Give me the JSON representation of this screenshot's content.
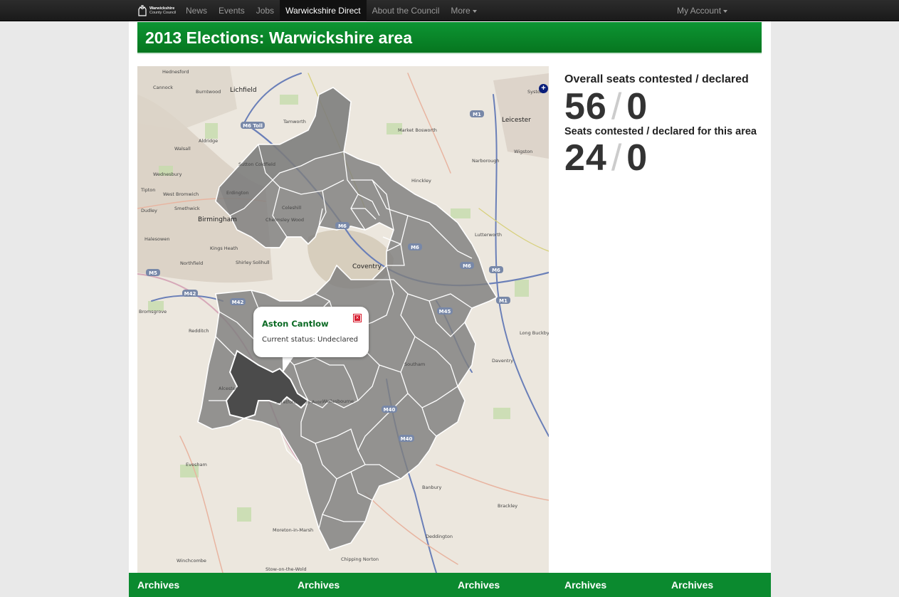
{
  "navbar": {
    "brand": {
      "line1": "Warwickshire",
      "line2": "County Council"
    },
    "items": [
      {
        "label": "News"
      },
      {
        "label": "Events"
      },
      {
        "label": "Jobs"
      },
      {
        "label": "Warwickshire Direct"
      },
      {
        "label": "About the Council"
      },
      {
        "label": "More"
      }
    ],
    "account": "My Account"
  },
  "page": {
    "title": "2013 Elections: Warwickshire area"
  },
  "map": {
    "colors": {
      "division_fill": "#7f7f7f",
      "selected_fill": "#4b4b4b",
      "boundary": "#ffffff"
    },
    "zoom_icon": "+",
    "labels": {
      "hednesford": "Hednesford",
      "cannock": "Cannock",
      "lichfield": "Lichfield",
      "burntwood": "Burntwood",
      "tamworth": "Tamworth",
      "m6toll": "M6 Toll",
      "walsall": "Walsall",
      "aldridge": "Aldridge",
      "sutton": "Sutton Coldfield",
      "erdington": "Erdington",
      "wednesbury": "Wednesbury",
      "westbromwich": "West Bromwich",
      "birmingham": "Birmingham",
      "smethwick": "Smethwick",
      "coleshill": "Coleshill",
      "chelmsley": "Chelmsley Wood",
      "m6": "M6",
      "coventry": "Coventry",
      "kingsheath": "Kings Heath",
      "northfield": "Northfield",
      "shirley": "Shirley",
      "solihull": "Solihull",
      "m42": "M42",
      "m5": "M5",
      "bromsgrove": "Bromsgrove",
      "redditch": "Redditch",
      "alcester": "Alcester",
      "stratford": "Stratford-upon-Avon",
      "wellesbourne": "Wellesbourne",
      "m40": "M40",
      "m45": "M45",
      "m1": "M1",
      "leicester": "Leicester",
      "wigston": "Wigston",
      "hinckley": "Hinckley",
      "narborough": "Narborough",
      "lutterworth": "Lutterworth",
      "marketbosworth": "Market Bosworth",
      "longbuckby": "Long Buckby",
      "daventry": "Daventry",
      "evesham": "Evesham",
      "banbury": "Banbury",
      "brackley": "Brackley",
      "deddington": "Deddington",
      "moreton": "Moreton-in-Marsh",
      "chipping": "Chipping Norton",
      "stow": "Stow-on-the-Wold",
      "winchcombe": "Winchcombe",
      "syston": "Syston",
      "halesowen": "Halesowen",
      "southam": "Southam",
      "tipton": "Tipton",
      "dudley": "Dudley"
    }
  },
  "popup": {
    "name": "Aston Cantlow",
    "status": "Current status: Undeclared",
    "close_icon": "×"
  },
  "stats": {
    "overall_label": "Overall seats contested / declared",
    "overall_contested": "56",
    "overall_declared": "0",
    "area_label": "Seats contested / declared for this area",
    "area_contested": "24",
    "area_declared": "0",
    "separator": "/"
  },
  "footer": {
    "links": [
      "Archives",
      "Archives",
      "Archives",
      "Archives",
      "Archives"
    ]
  }
}
